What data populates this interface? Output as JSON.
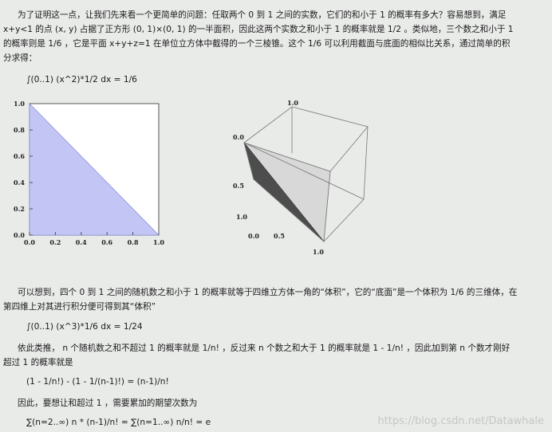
{
  "paragraphs": {
    "p1": [
      "为了证明这一点，让我们先来看一个更简单的问题：任取两个 0 到 1 之间的实数，它们的和小于 1 的概率有多大？容易想到，满足",
      "x+y<1 的点 (x, y) 占据了正方形 (0, 1)×(0, 1) 的一半面积，因此这两个实数之和小于 1 的概率就是 1/2 。类似地，三个数之和小于 1",
      "的概率则是 1/6 ，它是平面 x+y+z=1 在单位立方体中截得的一个三棱锥。这个 1/6 可以利用截面与底面的相似比关系，通过简单的积",
      "分求得："
    ],
    "formula1": "∫(0..1) (x^2)*1/2 dx = 1/6",
    "p2": [
      "可以想到，四个 0 到 1 之间的随机数之和小于 1 的概率就等于四维立方体一角的“体积”，它的“底面”是一个体积为 1/6 的三维体，在",
      "第四维上对其进行积分便可得到其“体积”"
    ],
    "formula2": "∫(0..1) (x^3)*1/6 dx = 1/24",
    "p3": [
      "依此类推， n 个随机数之和不超过 1 的概率就是 1/n! ，反过来 n 个数之和大于 1 的概率就是 1 - 1/n! ，因此加到第 n 个数才刚好",
      "超过 1 的概率就是"
    ],
    "formula3": "(1 - 1/n!) - (1 - 1/(n-1)!) = (n-1)/n!",
    "p4": "因此，要想让和超过 1 ，需要累加的期望次数为",
    "formula4": "∑(n=2..∞) n * (n-1)/n! = ∑(n=1..∞) n/n! = e",
    "watermark": "https://blog.csdn.net/Datawhale",
    "colors": {
      "triangle_fill": "#c3c6f5",
      "plot_bg": "#ffffff",
      "cube_dark": "#4d4d4d",
      "cube_light": "#d8d8d8"
    },
    "chart_data": [
      {
        "type": "area",
        "xlim": [
          0,
          1
        ],
        "ylim": [
          0,
          1
        ],
        "xticks": [
          "0.0",
          "0.2",
          "0.4",
          "0.6",
          "0.8",
          "1.0"
        ],
        "yticks": [
          "0.0",
          "0.2",
          "0.4",
          "0.6",
          "0.8",
          "1.0"
        ],
        "series": [
          {
            "x": [
              0,
              1
            ],
            "y": [
              1,
              0
            ],
            "fill": "below"
          }
        ]
      },
      {
        "type": "3d-surface",
        "tick_labels": [
          "1.0",
          "0.0",
          "0.5",
          "1.0",
          "0.0",
          "0.5",
          "1.0"
        ]
      }
    ]
  }
}
